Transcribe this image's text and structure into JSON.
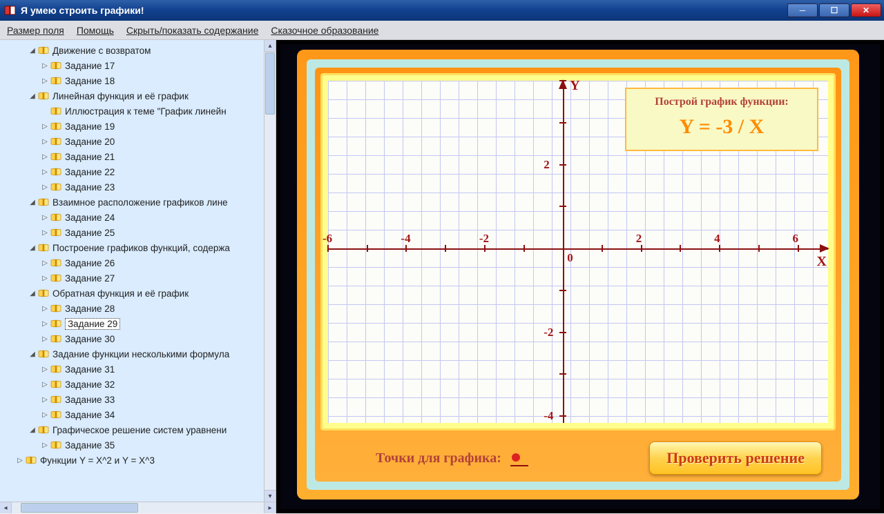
{
  "window": {
    "title": "Я умею строить графики!"
  },
  "menu": {
    "field_size": "Размер поля",
    "help": "Помощь",
    "toggle_toc": "Скрыть/показать содержание",
    "fairy_edu": "Сказочное образование"
  },
  "tree": [
    {
      "lvl": 1,
      "expand": "▾",
      "label": "Движение с возвратом"
    },
    {
      "lvl": 2,
      "expand": "▸",
      "label": "Задание 17"
    },
    {
      "lvl": 2,
      "expand": "▸",
      "label": "Задание 18"
    },
    {
      "lvl": 1,
      "expand": "▾",
      "label": "Линейная функция и её график"
    },
    {
      "lvl": 2,
      "expand": "",
      "label": "Иллюстрация к теме \"График линейн"
    },
    {
      "lvl": 2,
      "expand": "▸",
      "label": "Задание 19"
    },
    {
      "lvl": 2,
      "expand": "▸",
      "label": "Задание 20"
    },
    {
      "lvl": 2,
      "expand": "▸",
      "label": "Задание 21"
    },
    {
      "lvl": 2,
      "expand": "▸",
      "label": "Задание 22"
    },
    {
      "lvl": 2,
      "expand": "▸",
      "label": "Задание 23"
    },
    {
      "lvl": 1,
      "expand": "▾",
      "label": "Взаимное расположение графиков лине"
    },
    {
      "lvl": 2,
      "expand": "▸",
      "label": "Задание 24"
    },
    {
      "lvl": 2,
      "expand": "▸",
      "label": "Задание 25"
    },
    {
      "lvl": 1,
      "expand": "▾",
      "label": "Построение графиков функций, содержа"
    },
    {
      "lvl": 2,
      "expand": "▸",
      "label": "Задание 26"
    },
    {
      "lvl": 2,
      "expand": "▸",
      "label": "Задание 27"
    },
    {
      "lvl": 1,
      "expand": "▾",
      "label": "Обратная функция и её график"
    },
    {
      "lvl": 2,
      "expand": "▸",
      "label": "Задание 28"
    },
    {
      "lvl": 2,
      "expand": "▸",
      "label": "Задание 29",
      "selected": true
    },
    {
      "lvl": 2,
      "expand": "▸",
      "label": "Задание 30"
    },
    {
      "lvl": 1,
      "expand": "▾",
      "label": "Задание функции несколькими формула"
    },
    {
      "lvl": 2,
      "expand": "▸",
      "label": "Задание 31"
    },
    {
      "lvl": 2,
      "expand": "▸",
      "label": "Задание 32"
    },
    {
      "lvl": 2,
      "expand": "▸",
      "label": "Задание 33"
    },
    {
      "lvl": 2,
      "expand": "▸",
      "label": "Задание 34"
    },
    {
      "lvl": 1,
      "expand": "▾",
      "label": "Графическое решение систем уравнени"
    },
    {
      "lvl": 2,
      "expand": "▸",
      "label": "Задание 35"
    },
    {
      "lvl": 0,
      "expand": "▸",
      "label": "Функции Y = X^2 и Y = X^3"
    }
  ],
  "task": {
    "heading": "Построй график функции:",
    "equation": "Y = -3 / X"
  },
  "axis": {
    "y_cap": "Y",
    "x_cap": "X",
    "origin": "0",
    "x_ticks": [
      "-6",
      "-4",
      "-2",
      "2",
      "4",
      "6"
    ],
    "y_ticks": [
      "2",
      "-2",
      "-4"
    ]
  },
  "bottom": {
    "points": "Точки для графика:",
    "check": "Проверить решение"
  },
  "chart_data": {
    "type": "line",
    "title": "Построй график функции: Y = -3 / X",
    "xlabel": "X",
    "ylabel": "Y",
    "xlim": [
      -6,
      6
    ],
    "ylim": [
      -4,
      4
    ],
    "x_tick_labels": [
      -6,
      -4,
      -2,
      2,
      4,
      6
    ],
    "y_tick_labels": [
      -4,
      -2,
      2
    ],
    "series": []
  }
}
